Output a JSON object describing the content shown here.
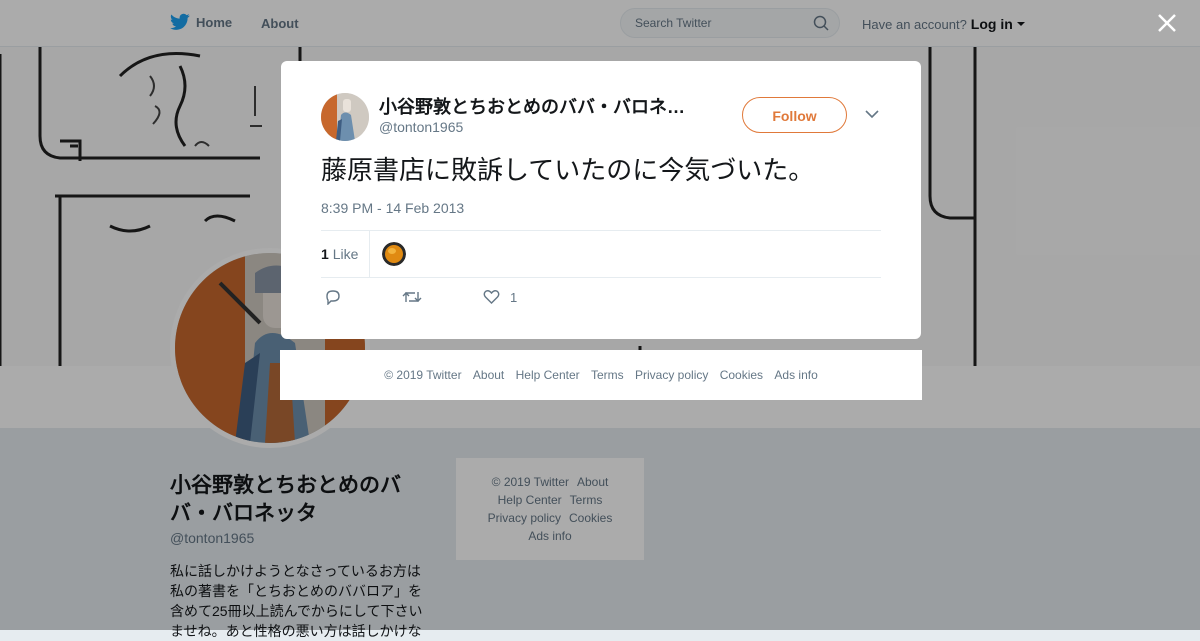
{
  "nav": {
    "home_label": "Home",
    "about_label": "About",
    "search_placeholder": "Search Twitter",
    "account_prompt": "Have an account?",
    "login_label": "Log in"
  },
  "profile": {
    "name": "小谷野敦とちおとめのババ・バロネッタ",
    "handle": "@tonton1965",
    "bio": "私に話しかけようとなさっているお方は私の著書を「とちおとめのババロア」を含めて25冊以上読んでからにして下さいませね。あと性格の悪い方は話しかけな"
  },
  "side_footer": {
    "copyright": "© 2019 Twitter",
    "about": "About",
    "help": "Help Center",
    "terms": "Terms",
    "privacy": "Privacy policy",
    "cookies": "Cookies",
    "ads": "Ads info"
  },
  "tweet": {
    "author_name": "小谷野敦とちおとめのババ・バロネ…",
    "author_handle": "@tonton1965",
    "follow_label": "Follow",
    "text": "藤原書店に敗訴していたのに今気づいた。",
    "timestamp": "8:39 PM - 14 Feb 2013",
    "like_count": "1",
    "like_label": "Like",
    "action_like_count": "1"
  },
  "modal_footer": {
    "copyright": "© 2019 Twitter",
    "about": "About",
    "help": "Help Center",
    "terms": "Terms",
    "privacy": "Privacy policy",
    "cookies": "Cookies",
    "ads": "Ads info"
  },
  "colors": {
    "follow_accent": "#e0793a",
    "twitter_blue": "#1da1f2",
    "muted_text": "#657786"
  }
}
